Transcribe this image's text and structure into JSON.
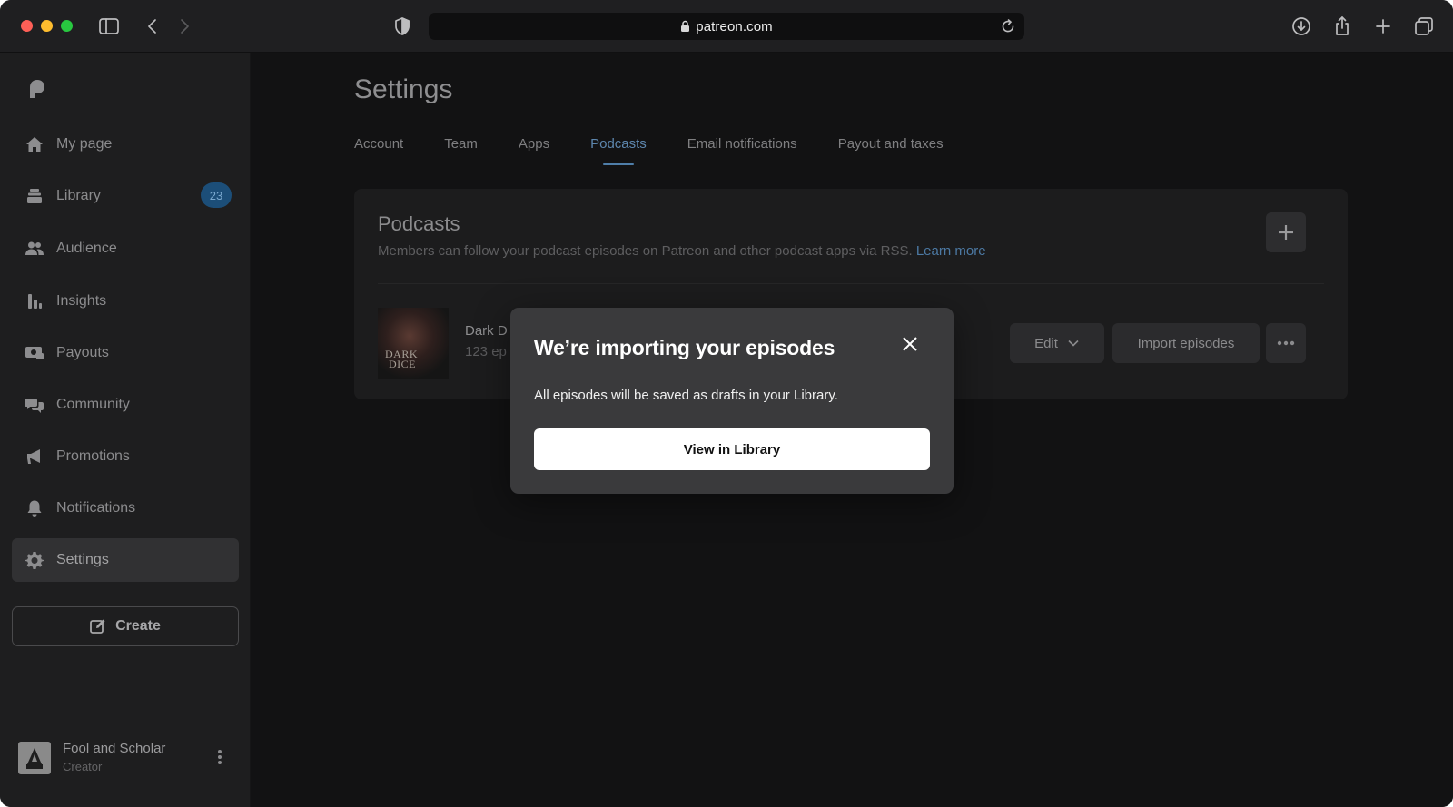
{
  "browser": {
    "url": "patreon.com",
    "icons": [
      "sidebar-toggle-icon",
      "back-icon",
      "forward-icon",
      "shield-icon",
      "lock-icon",
      "reload-icon",
      "download-icon",
      "share-icon",
      "new-tab-icon",
      "tab-overview-icon"
    ]
  },
  "sidebar": {
    "items": [
      {
        "label": "My page",
        "icon": "home-icon"
      },
      {
        "label": "Library",
        "icon": "library-icon",
        "badge": "23"
      },
      {
        "label": "Audience",
        "icon": "audience-icon"
      },
      {
        "label": "Insights",
        "icon": "insights-icon"
      },
      {
        "label": "Payouts",
        "icon": "payouts-icon"
      },
      {
        "label": "Community",
        "icon": "community-icon"
      },
      {
        "label": "Promotions",
        "icon": "megaphone-icon"
      },
      {
        "label": "Notifications",
        "icon": "bell-icon"
      },
      {
        "label": "Settings",
        "icon": "gear-icon",
        "active": true
      }
    ],
    "create_label": "Create",
    "profile": {
      "name": "Fool and Scholar",
      "role": "Creator"
    }
  },
  "main": {
    "title": "Settings",
    "tabs": [
      {
        "label": "Account"
      },
      {
        "label": "Team"
      },
      {
        "label": "Apps"
      },
      {
        "label": "Podcasts",
        "active": true
      },
      {
        "label": "Email notifications"
      },
      {
        "label": "Payout and taxes"
      }
    ],
    "podcasts_card": {
      "title": "Podcasts",
      "description": "Members can follow your podcast episodes on Patreon and other podcast apps via RSS.",
      "learn_more": "Learn more",
      "podcast": {
        "name": "Dark D",
        "count": "123 ep",
        "cover_text_line1": "DARK",
        "cover_text_line2": "DICE"
      },
      "edit_label": "Edit",
      "import_label": "Import episodes"
    }
  },
  "modal": {
    "title": "We’re importing your episodes",
    "body": "All episodes will be saved as drafts in your Library.",
    "button": "View in Library"
  },
  "colors": {
    "accent_tab": "#5d86ad",
    "badge_bg": "#1c4e78",
    "modal_bg": "#3a3a3c"
  }
}
